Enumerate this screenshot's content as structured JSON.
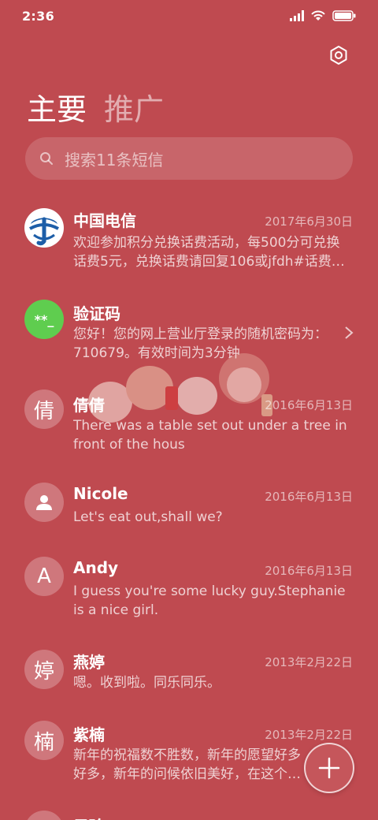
{
  "status": {
    "time": "2:36"
  },
  "tabs": [
    {
      "label": "主要"
    },
    {
      "label": "推广"
    }
  ],
  "search": {
    "placeholder": "搜索11条短信"
  },
  "conversations": [
    {
      "name": "中国电信",
      "date": "2017年6月30日",
      "preview": "欢迎参加积分兑换话费活动，每500分可兑换话费5元，兑换话费请回复106或jfdh#话费…",
      "avatar": "logo"
    },
    {
      "name": "验证码",
      "date": "",
      "preview": "您好！您的网上营业厅登录的随机密码为：710679。有效时间为3分钟",
      "avatar": "**_"
    },
    {
      "name": "倩倩",
      "date": "2016年6月13日",
      "preview": "There was a table set out under a tree in front of the hous",
      "avatar": "倩"
    },
    {
      "name": "Nicole",
      "date": "2016年6月13日",
      "preview": "Let's eat out,shall we?",
      "avatar": "person"
    },
    {
      "name": "Andy",
      "date": "2016年6月13日",
      "preview": "I guess you're some lucky guy.Stephanie is a nice girl.",
      "avatar": "A"
    },
    {
      "name": "燕婷",
      "date": "2013年2月22日",
      "preview": "嗯。收到啦。同乐同乐。",
      "avatar": "婷"
    },
    {
      "name": "紫楠",
      "date": "2013年2月22日",
      "preview": "新年的祝福数不胜数，新年的愿望好多好多，新年的问候依旧美好，在这个温馨的时刻",
      "avatar": "楠"
    },
    {
      "name": "子玲",
      "date": "",
      "preview": "",
      "avatar": ""
    }
  ],
  "colors": {
    "background": "#bf4a50",
    "verify_avatar": "#5fcd4f",
    "telecom_blue": "#1d5ea8"
  }
}
